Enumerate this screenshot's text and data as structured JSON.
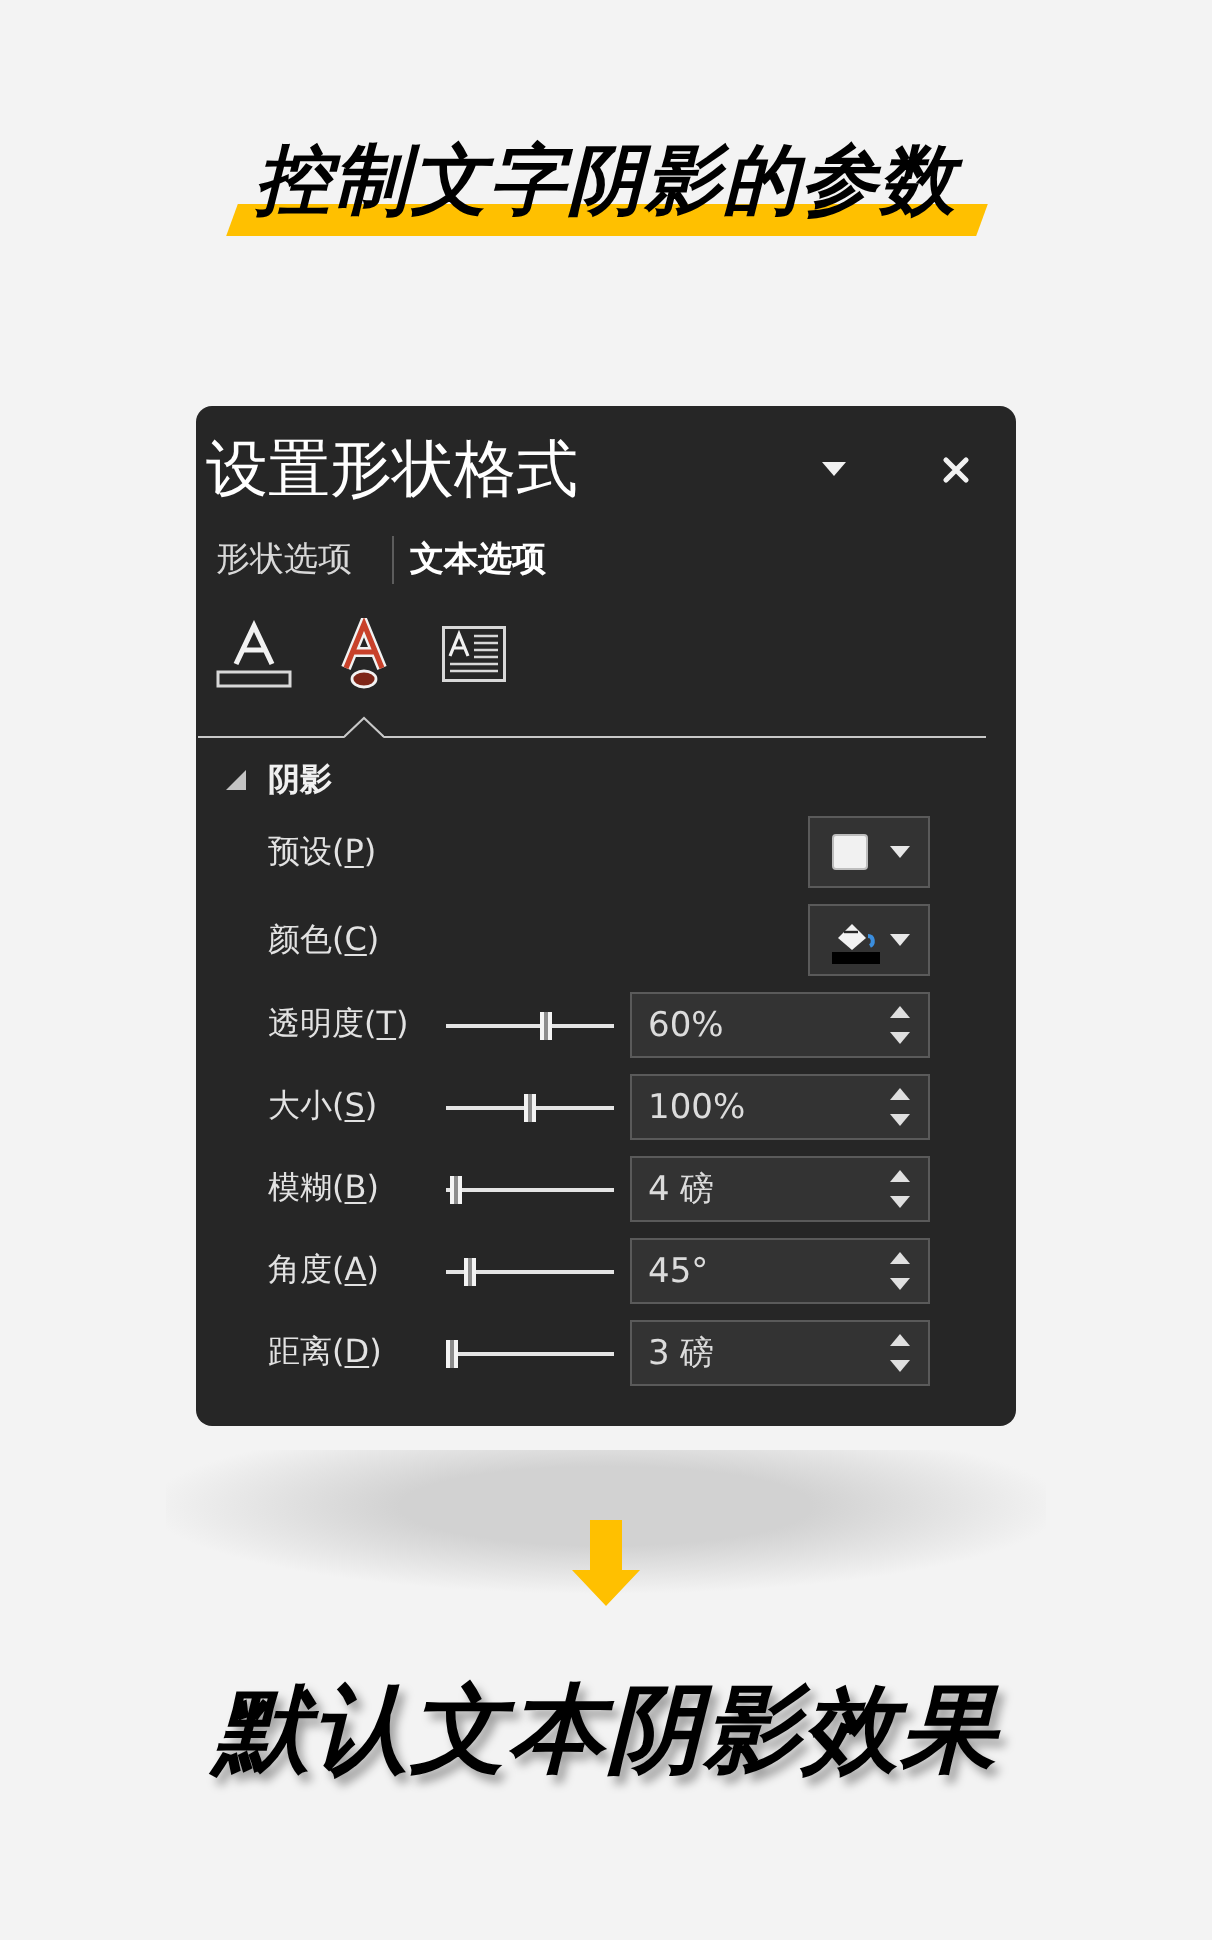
{
  "heading": {
    "text": "控制文字阴影的参数"
  },
  "panel": {
    "title": "设置形状格式",
    "tabs": [
      {
        "label": "形状选项",
        "selected": false
      },
      {
        "label": "文本选项",
        "selected": true
      }
    ],
    "icon_tabs": [
      {
        "kind": "fill",
        "selected": false
      },
      {
        "kind": "effects",
        "selected": true
      },
      {
        "kind": "textbox",
        "selected": false
      }
    ],
    "section": {
      "title": "阴影",
      "expanded": true,
      "pickers": [
        {
          "kind": "preset",
          "label_prefix": "预设(",
          "access_key": "P",
          "label_suffix": ")"
        },
        {
          "kind": "color",
          "label_prefix": "颜色(",
          "access_key": "C",
          "label_suffix": ")"
        }
      ],
      "sliders": [
        {
          "label_prefix": "透明度(",
          "access_key": "T",
          "label_suffix": ")",
          "level": 0.6,
          "value": "60%"
        },
        {
          "label_prefix": "大小(",
          "access_key": "S",
          "label_suffix": ")",
          "level": 0.5,
          "value": "100%"
        },
        {
          "label_prefix": "模糊(",
          "access_key": "B",
          "label_suffix": ")",
          "level": 0.06,
          "value": "4 磅"
        },
        {
          "label_prefix": "角度(",
          "access_key": "A",
          "label_suffix": ")",
          "level": 0.14,
          "value": "45°"
        },
        {
          "label_prefix": "距离(",
          "access_key": "D",
          "label_suffix": ")",
          "level": 0.04,
          "value": "3 磅"
        }
      ]
    }
  },
  "caption": {
    "text": "默认文本阴影效果"
  }
}
